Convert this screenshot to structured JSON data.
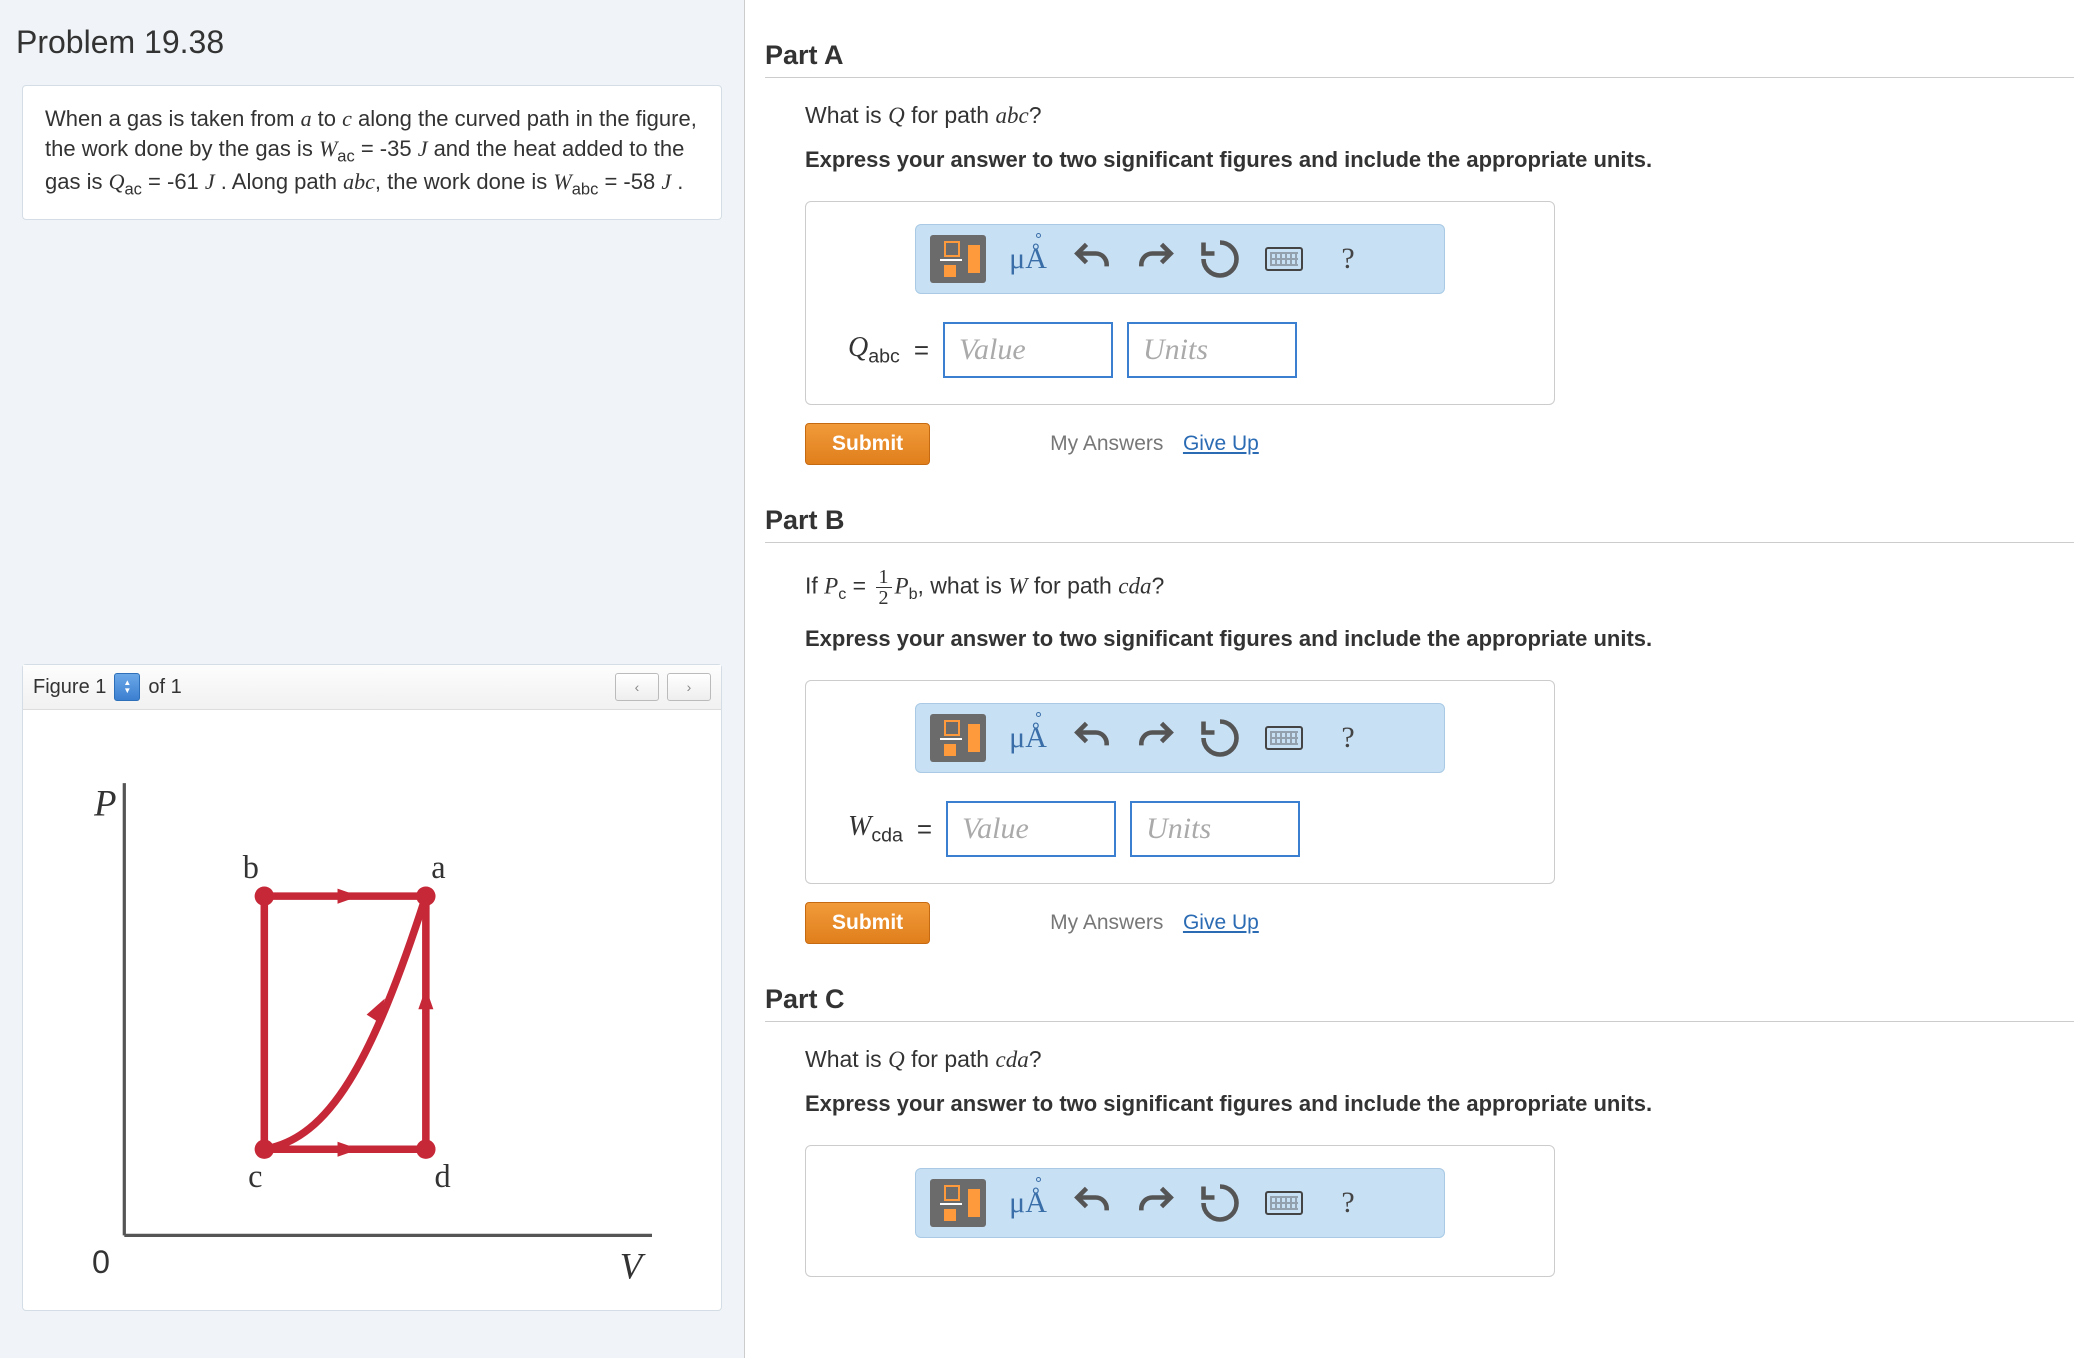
{
  "problem": {
    "title": "Problem 19.38",
    "text_parts": {
      "p1": "When a gas is taken from ",
      "a": "a",
      "p2": " to ",
      "c": "c",
      "p3": " along the curved path in the figure, the work done by the gas is ",
      "Wac_sym": "W",
      "Wac_sub": "ac",
      "Wac_val": " = -35 ",
      "J1": "J",
      "p4": " and the heat added to the gas is ",
      "Qac_sym": "Q",
      "Qac_sub": "ac",
      "Qac_val": " = -61 ",
      "J2": "J",
      "p5": " . Along path ",
      "abc": "abc",
      "p6": ", the work done is ",
      "Wabc_sym": "W",
      "Wabc_sub": "abc",
      "Wabc_val": " = -58 ",
      "J3": "J",
      "p7": " ."
    }
  },
  "figure": {
    "label": "Figure",
    "number": "1",
    "of_text": "of 1",
    "axis_y": "P",
    "axis_x": "V",
    "origin": "0",
    "points": {
      "a": "a",
      "b": "b",
      "c": "c",
      "d": "d"
    }
  },
  "parts": {
    "A": {
      "title": "Part A",
      "q_prefix": "What is ",
      "q_sym": "Q",
      "q_mid": " for path ",
      "q_path": "abc",
      "q_suffix": "?",
      "instruction": "Express your answer to two significant figures and include the appropriate units.",
      "var_sym": "Q",
      "var_sub": "abc",
      "value_ph": "Value",
      "units_ph": "Units"
    },
    "B": {
      "title": "Part B",
      "q_if": "If ",
      "pc": "P",
      "pc_sub": "c",
      "eq": " = ",
      "frac_n": "1",
      "frac_d": "2",
      "pb": "P",
      "pb_sub": "b",
      "q_mid1": ", what is ",
      "w": "W",
      "q_mid2": " for path ",
      "q_path": "cda",
      "q_suffix": "?",
      "instruction": "Express your answer to two significant figures and include the appropriate units.",
      "var_sym": "W",
      "var_sub": "cda",
      "value_ph": "Value",
      "units_ph": "Units"
    },
    "C": {
      "title": "Part C",
      "q_prefix": "What is ",
      "q_sym": "Q",
      "q_mid": " for path ",
      "q_path": "cda",
      "q_suffix": "?",
      "instruction": "Express your answer to two significant figures and include the appropriate units."
    }
  },
  "buttons": {
    "submit": "Submit",
    "my_answers": "My Answers",
    "give_up": "Give Up",
    "mu_label": "μÅ",
    "help": "?"
  }
}
